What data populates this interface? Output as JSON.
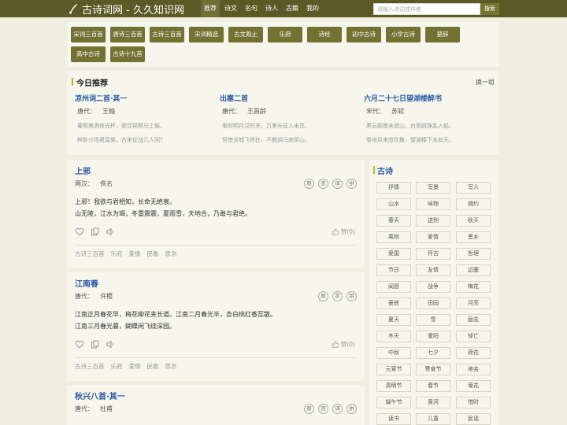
{
  "header": {
    "site_title": "古诗词网 - 久久知识网",
    "nav": [
      "推荐",
      "诗文",
      "名句",
      "诗人",
      "古籍",
      "我的"
    ],
    "active_nav": "推荐",
    "search_placeholder": "请输入诗词或作者",
    "search_button": "搜索"
  },
  "categories": [
    "宋词三百首",
    "唐诗三百首",
    "古诗三百首",
    "宋词精选",
    "古文观止",
    "乐府",
    "诗经",
    "初中古诗",
    "小学古诗",
    "楚辞",
    "高中古诗",
    "古诗十九首"
  ],
  "today": {
    "title": "今日推荐",
    "change": "换一组",
    "items": [
      {
        "title": "凉州词二首·其一",
        "dynasty": "唐代：",
        "author": "王翰",
        "line1": "葡萄美酒夜光杯，欲饮琵琶马上催。",
        "line2": "醉卧沙场君莫笑，古来征战几人回？"
      },
      {
        "title": "出塞二首",
        "dynasty": "唐代：",
        "author": "王昌龄",
        "line1": "秦时明月汉时关，万里长征人未还。",
        "line2": "但使龙城飞将在，不教胡马度阴山。"
      },
      {
        "title": "六月二十七日望湖楼醉书",
        "dynasty": "宋代：",
        "author": "苏轼",
        "line1": "黑云翻墨未遮山，白雨跳珠乱入船。",
        "line2": "卷地风来忽吹散，望湖楼下水如天。"
      }
    ]
  },
  "poems": [
    {
      "title": "上邪",
      "dynasty": "两汉：",
      "author": "佚名",
      "circles": [
        "原",
        "赏",
        "译",
        "拼"
      ],
      "lines": [
        "上邪！我欲与君相知，长命无绝衰。",
        "山无陵，江水为竭，冬雷震震，夏雨雪，天地合，乃敢与君绝。"
      ],
      "like": "赞(0)",
      "tags": [
        "古诗三百首",
        "乐府",
        "爱情",
        "民歌",
        "思念"
      ]
    },
    {
      "title": "江南春",
      "dynasty": "唐代：",
      "author": "许稷",
      "circles": [
        "原",
        "赏",
        "拼"
      ],
      "lines": [
        "江南正月春花早，梅花柳花夹长道。江南二月春光半，杏白桃红香蕊散。",
        "江南三月春光暮，蝴蝶闲飞绕深园。"
      ],
      "like": "赞(0)",
      "tags": [
        "古诗三百首",
        "乐府",
        "爱情",
        "民歌",
        "思念"
      ]
    },
    {
      "title": "秋兴八首·其一",
      "dynasty": "唐代：",
      "author": "杜甫",
      "circles": [
        "原",
        "赏",
        "译",
        "拼"
      ],
      "lines": [],
      "like": "",
      "tags": []
    }
  ],
  "sidebar": {
    "title": "古诗",
    "tags": [
      "抒情",
      "写景",
      "写人",
      "山水",
      "咏物",
      "婉约",
      "春天",
      "送别",
      "秋天",
      "离别",
      "爱情",
      "思乡",
      "爱国",
      "怀古",
      "哲理",
      "节日",
      "友情",
      "边塞",
      "闺怨",
      "战争",
      "梅花",
      "豪放",
      "田园",
      "月亮",
      "夏天",
      "雪",
      "励志",
      "冬天",
      "重阳",
      "悼亡",
      "中秋",
      "七夕",
      "荷花",
      "元宵节",
      "寒食节",
      "地名",
      "清明节",
      "春节",
      "菊花",
      "端午节",
      "黄河",
      "惜时",
      "读书",
      "儿童",
      "民谣"
    ]
  },
  "colors": {
    "header": "#5b5a26",
    "accent": "#737232",
    "link": "#2b5aa5",
    "background": "#efeedf",
    "panel": "#f6f6ec"
  }
}
